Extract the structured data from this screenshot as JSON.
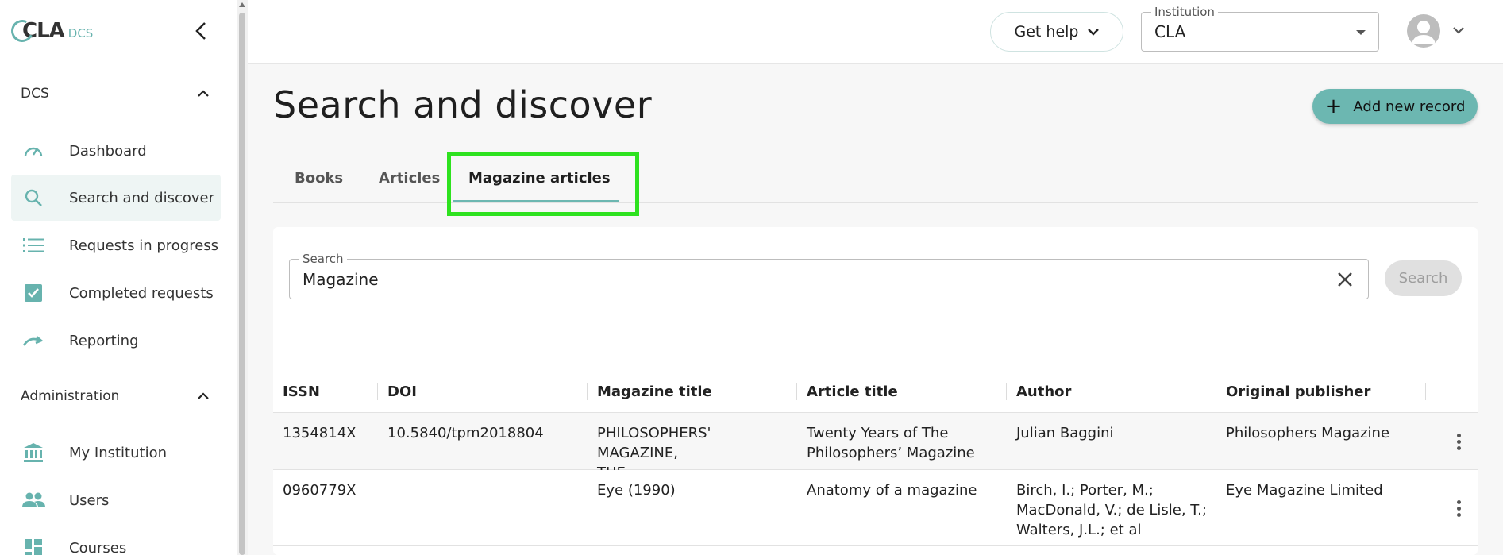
{
  "logo": {
    "main": "CLA",
    "sub": "DCS"
  },
  "sidebar": {
    "sections": [
      {
        "title": "DCS",
        "items": [
          {
            "label": "Dashboard",
            "icon": "speedometer-icon",
            "active": false
          },
          {
            "label": "Search and discover",
            "icon": "search-icon",
            "active": true
          },
          {
            "label": "Requests in progress",
            "icon": "list-icon",
            "active": false
          },
          {
            "label": "Completed requests",
            "icon": "checkbox-icon",
            "active": false
          },
          {
            "label": "Reporting",
            "icon": "redo-arrow-icon",
            "active": false
          }
        ]
      },
      {
        "title": "Administration",
        "items": [
          {
            "label": "My Institution",
            "icon": "bank-icon",
            "active": false
          },
          {
            "label": "Users",
            "icon": "people-icon",
            "active": false
          },
          {
            "label": "Courses",
            "icon": "dashboard-grid-icon",
            "active": false
          }
        ]
      }
    ]
  },
  "header": {
    "get_help": "Get help",
    "institution": {
      "label": "Institution",
      "value": "CLA"
    }
  },
  "main": {
    "title": "Search and discover",
    "add_button": "Add new record",
    "tabs": [
      {
        "label": "Books"
      },
      {
        "label": "Articles"
      },
      {
        "label": "Magazine articles"
      }
    ],
    "search": {
      "label": "Search",
      "value": "Magazine",
      "button": "Search"
    },
    "table": {
      "columns": [
        "ISSN",
        "DOI",
        "Magazine title",
        "Article title",
        "Author",
        "Original publisher"
      ],
      "rows": [
        {
          "issn": "1354814X",
          "doi": "10.5840/tpm2018804",
          "magazine_title": [
            "PHILOSOPHERS' MAGAZINE,",
            "THE"
          ],
          "article_title": [
            "Twenty Years of The",
            "Philosophers’ Magazine"
          ],
          "author": [
            "Julian Baggini"
          ],
          "publisher": "Philosophers Magazine"
        },
        {
          "issn": "0960779X",
          "doi": "",
          "magazine_title": [
            "Eye (1990)"
          ],
          "article_title": [
            "Anatomy of a magazine"
          ],
          "author": [
            "Birch, I.; Porter, M.;",
            "MacDonald, V.; de Lisle, T.;",
            "Walters, J.L.; et al"
          ],
          "publisher": "Eye Magazine Limited"
        }
      ]
    }
  },
  "colors": {
    "accent": "#6cb7b1",
    "highlight": "#2ee21f"
  }
}
